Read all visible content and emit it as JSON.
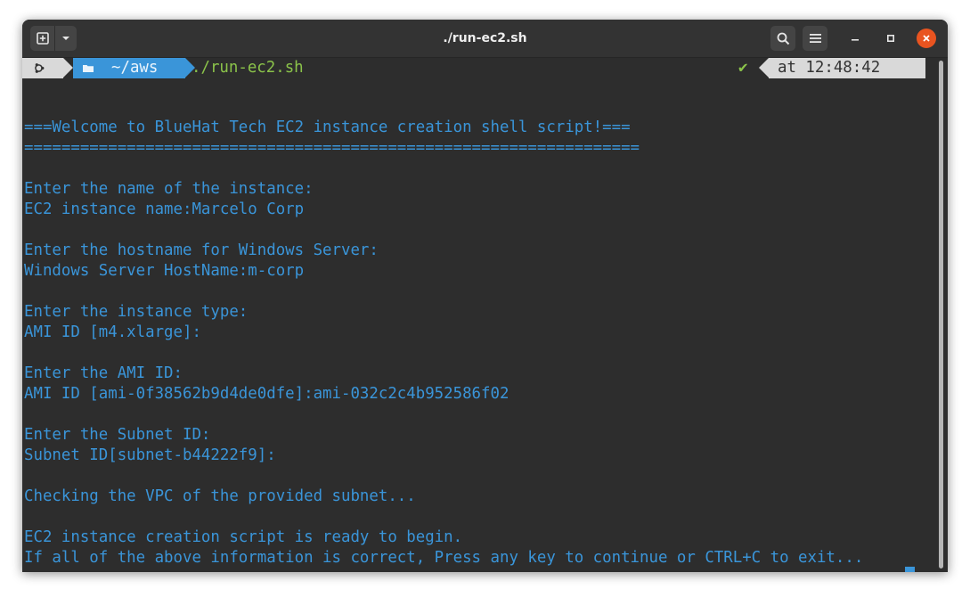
{
  "window": {
    "title": "./run-ec2.sh"
  },
  "prompt": {
    "directory": "~/aws",
    "command": "./run-ec2.sh",
    "status_symbol": "✔",
    "time_label": "at 12:48:42"
  },
  "output": {
    "welcome": "===Welcome to BlueHat Tech EC2 instance creation shell script!===",
    "rule": "==================================================================",
    "q_name": "Enter the name of the instance:",
    "a_name": "EC2 instance name:Marcelo Corp",
    "q_hostname": "Enter the hostname for Windows Server:",
    "a_hostname": "Windows Server HostName:m-corp",
    "q_type": "Enter the instance type:",
    "a_type": "AMI ID [m4.xlarge]:",
    "q_ami": "Enter the AMI ID:",
    "a_ami": "AMI ID [ami-0f38562b9d4de0dfe]:ami-032c2c4b952586f02",
    "q_subnet": "Enter the Subnet ID:",
    "a_subnet": "Subnet ID[subnet-b44222f9]:",
    "checking": "Checking the VPC of the provided subnet...",
    "ready": "EC2 instance creation script is ready to begin.",
    "confirm": "If all of the above information is correct, Press any key to continue or CTRL+C to exit..."
  },
  "colors": {
    "text": "#3a95d9",
    "command": "#8bc34a",
    "close": "#e95420"
  },
  "icons": {
    "new_tab": "new-tab-icon",
    "dropdown": "chevron-down-icon",
    "search": "search-icon",
    "menu": "hamburger-menu-icon",
    "minimize": "minimize-icon",
    "maximize": "maximize-icon",
    "close": "close-icon",
    "os": "ubuntu-icon",
    "folder": "folder-icon"
  }
}
